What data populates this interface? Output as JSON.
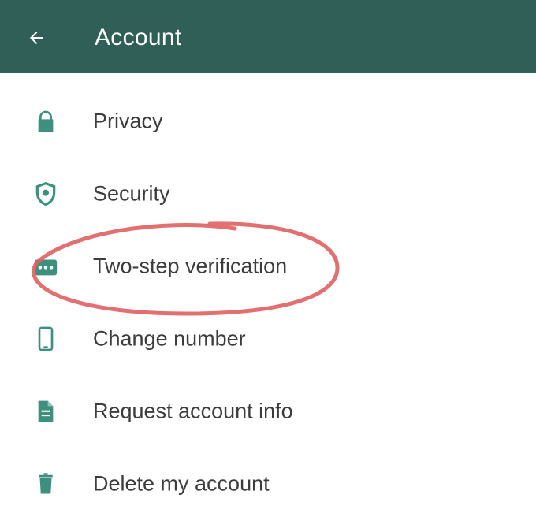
{
  "header": {
    "title": "Account"
  },
  "colors": {
    "app_bar": "#2f5f56",
    "icon": "#3f8f7f",
    "annotation": "#e06060"
  },
  "items": [
    {
      "label": "Privacy",
      "icon": "lock-icon"
    },
    {
      "label": "Security",
      "icon": "shield-icon"
    },
    {
      "label": "Two-step verification",
      "icon": "dots-password-icon"
    },
    {
      "label": "Change number",
      "icon": "phone-icon"
    },
    {
      "label": "Request account info",
      "icon": "document-icon"
    },
    {
      "label": "Delete my account",
      "icon": "trash-icon"
    }
  ]
}
